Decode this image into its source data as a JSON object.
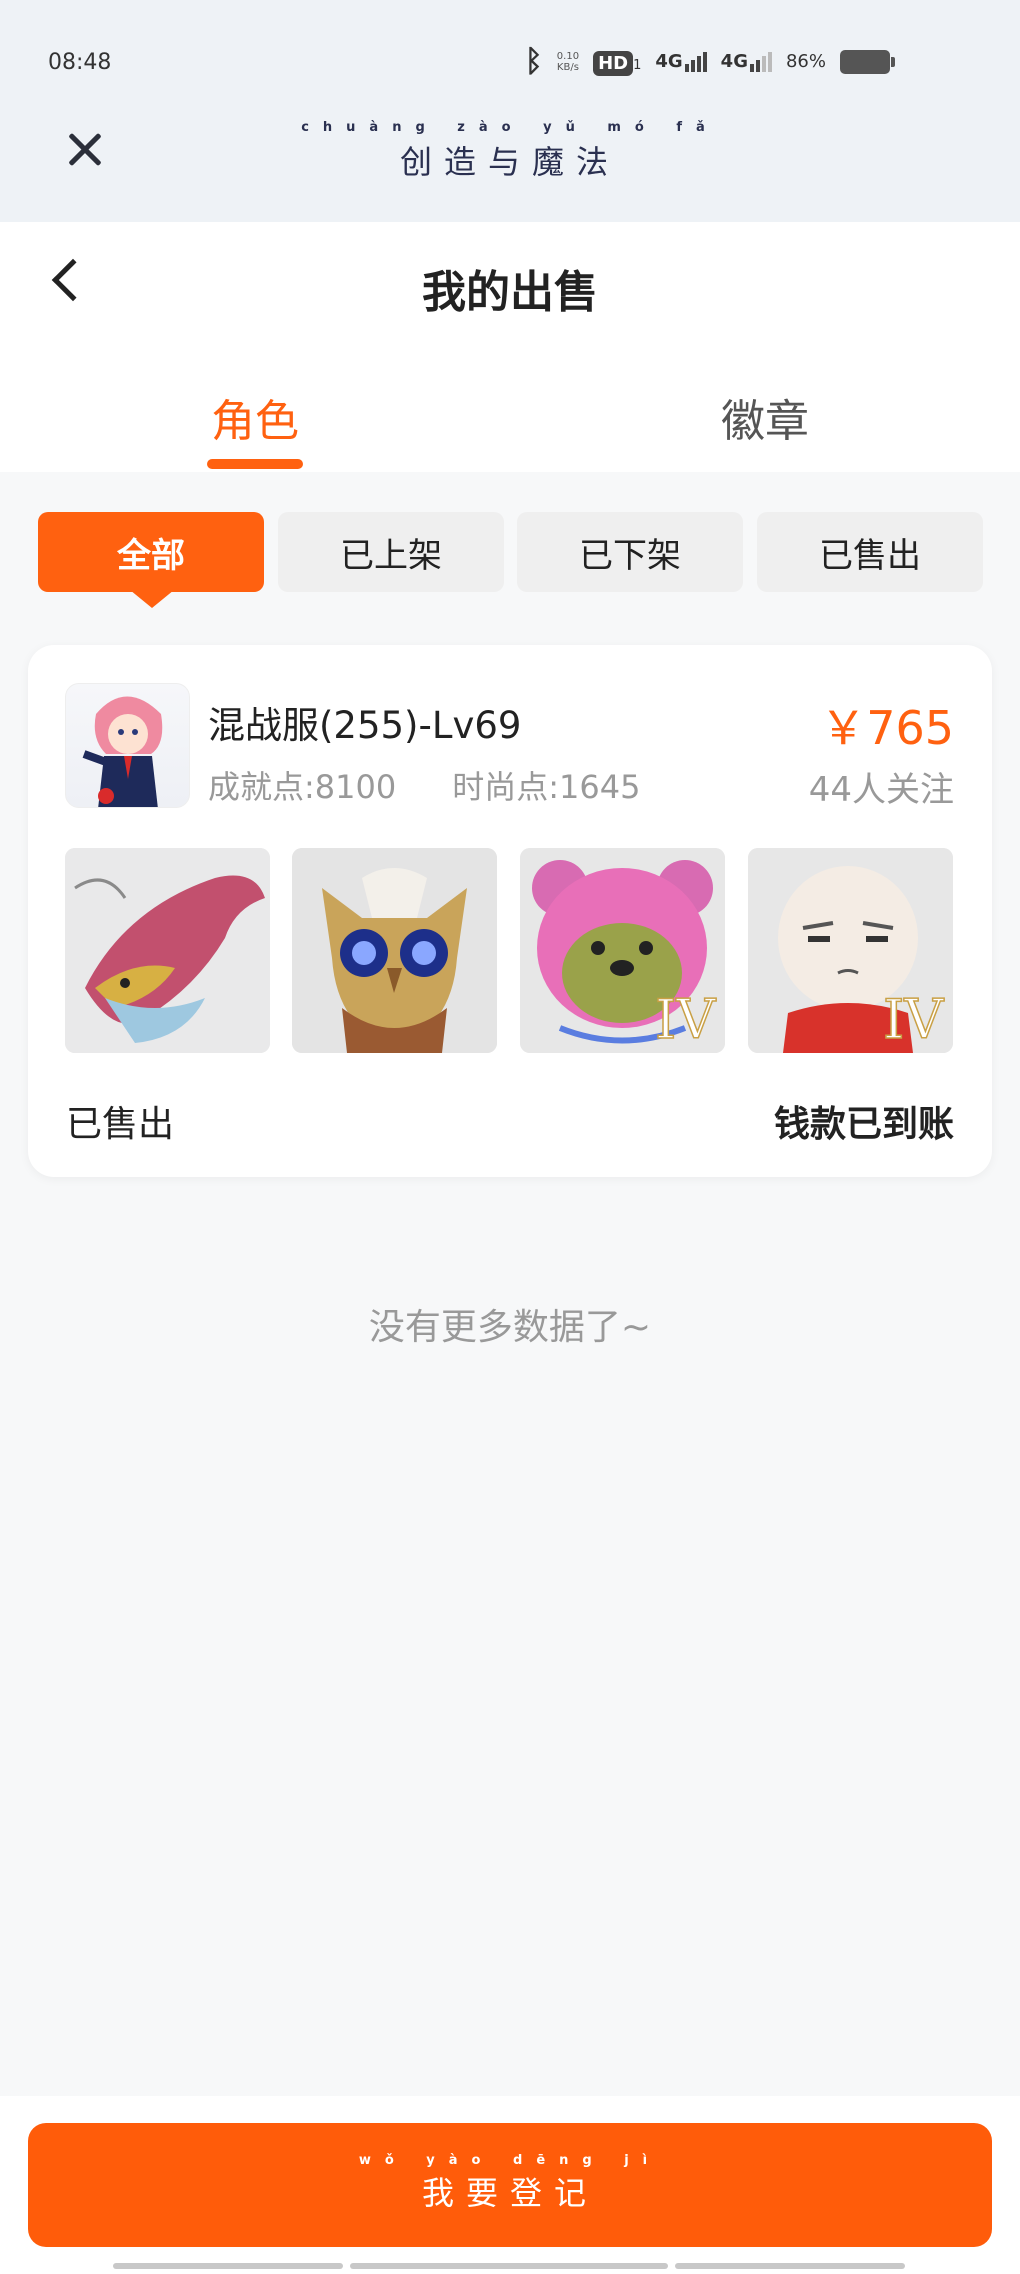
{
  "status_bar": {
    "time": "08:48",
    "net_speed_top": "0.10",
    "net_speed_bottom": "KB/s",
    "hd": "HD",
    "hd_sub": "1",
    "network1": "4G",
    "network2": "4G",
    "battery": "86%"
  },
  "app_bar": {
    "brand_pinyin": "chuàng zào yǔ mó fǎ",
    "brand_name": "创造与魔法"
  },
  "header": {
    "title": "我的出售"
  },
  "tabs": [
    {
      "label": "角色",
      "active": true
    },
    {
      "label": "徽章",
      "active": false
    }
  ],
  "filters": [
    "全部",
    "已上架",
    "已下架",
    "已售出"
  ],
  "listing": {
    "title": "混战服(255)-Lv69",
    "achievement": "成就点:8100",
    "fashion": "时尚点:1645",
    "price": "￥765",
    "followers": "44人关注",
    "status": "已售出",
    "payment": "钱款已到账",
    "badge_text": "IV"
  },
  "footer_text": "没有更多数据了~",
  "login_button": {
    "pinyin": "wǒ yào dēng jì",
    "label": "我要登记"
  },
  "colors": {
    "accent": "#ff6110",
    "button": "#ff5c0a",
    "muted_text": "#999999"
  }
}
